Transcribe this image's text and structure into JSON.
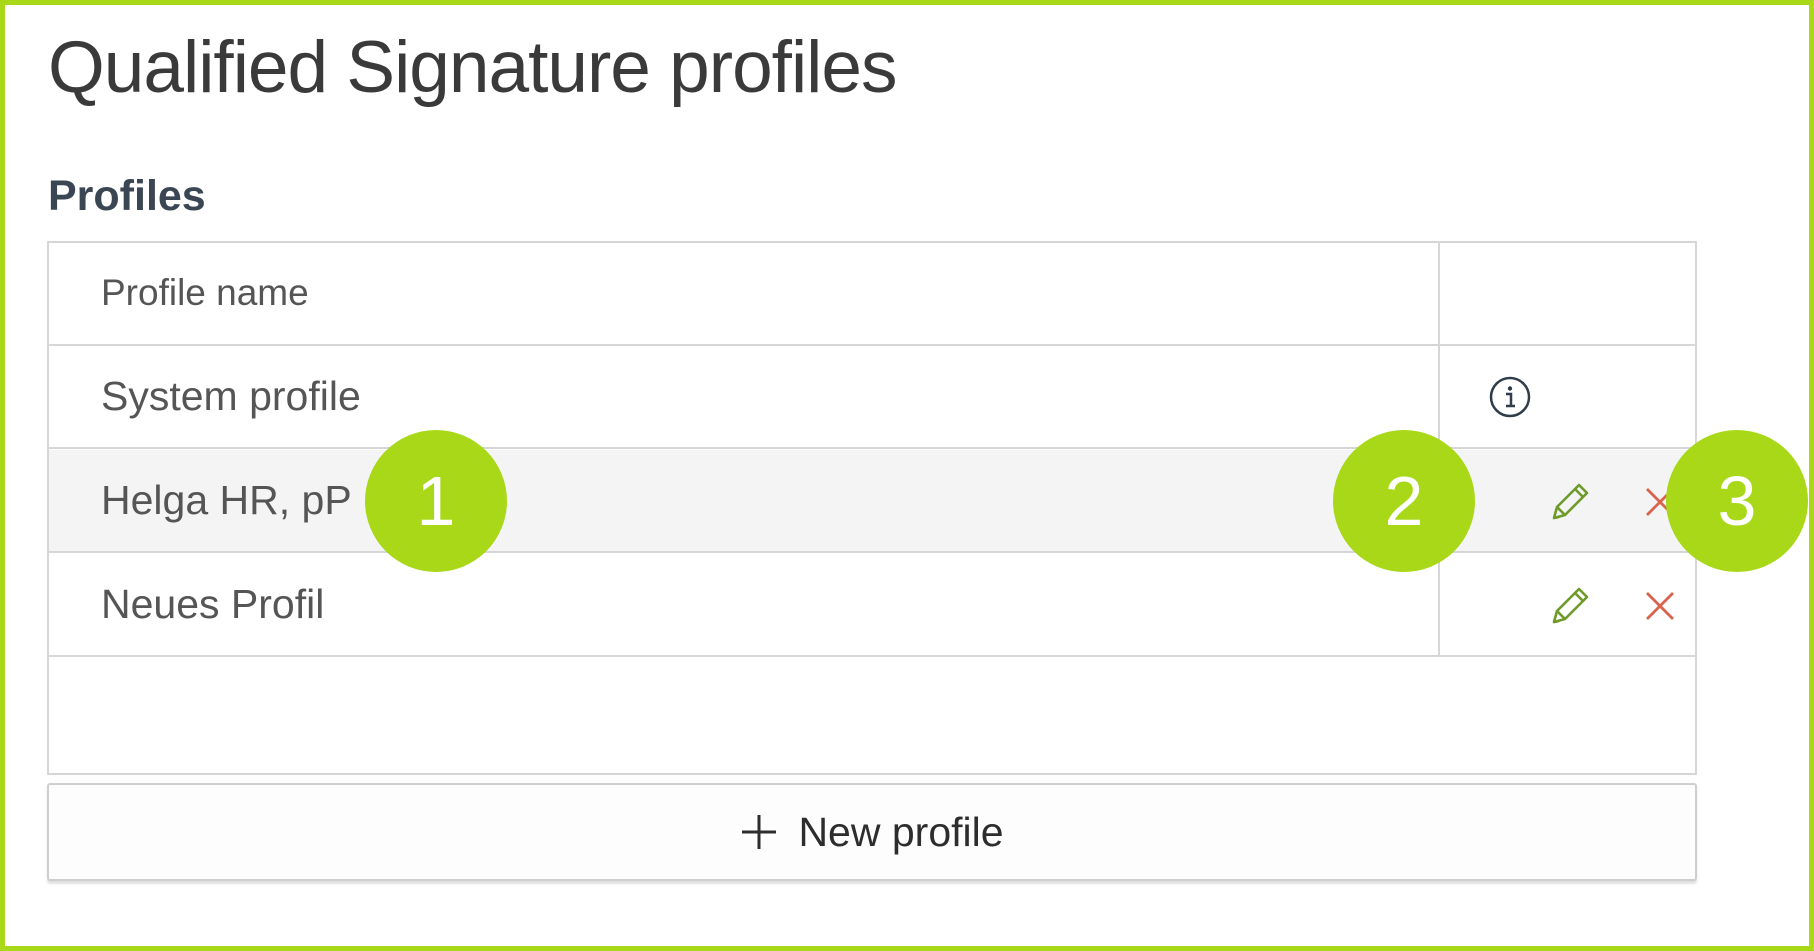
{
  "page": {
    "title": "Qualified Signature profiles"
  },
  "section": {
    "title": "Profiles"
  },
  "table": {
    "header": {
      "profile_name": "Profile name"
    },
    "rows": [
      {
        "name": "System profile",
        "actions": [
          "info-icon"
        ]
      },
      {
        "name": "Helga HR, pP",
        "actions": [
          "edit-icon",
          "delete-icon"
        ]
      },
      {
        "name": "Neues Profil",
        "actions": [
          "edit-icon",
          "delete-icon"
        ]
      }
    ]
  },
  "new_profile_button": {
    "label": "New profile",
    "icon": "plus-icon"
  },
  "callouts": [
    "1",
    "2",
    "3"
  ],
  "colors": {
    "accent": "#a8d818",
    "edit_icon": "#6e9a2a",
    "delete_icon": "#d9644e",
    "border": "#d6d6d6",
    "hover_row": "#f4f4f4"
  }
}
